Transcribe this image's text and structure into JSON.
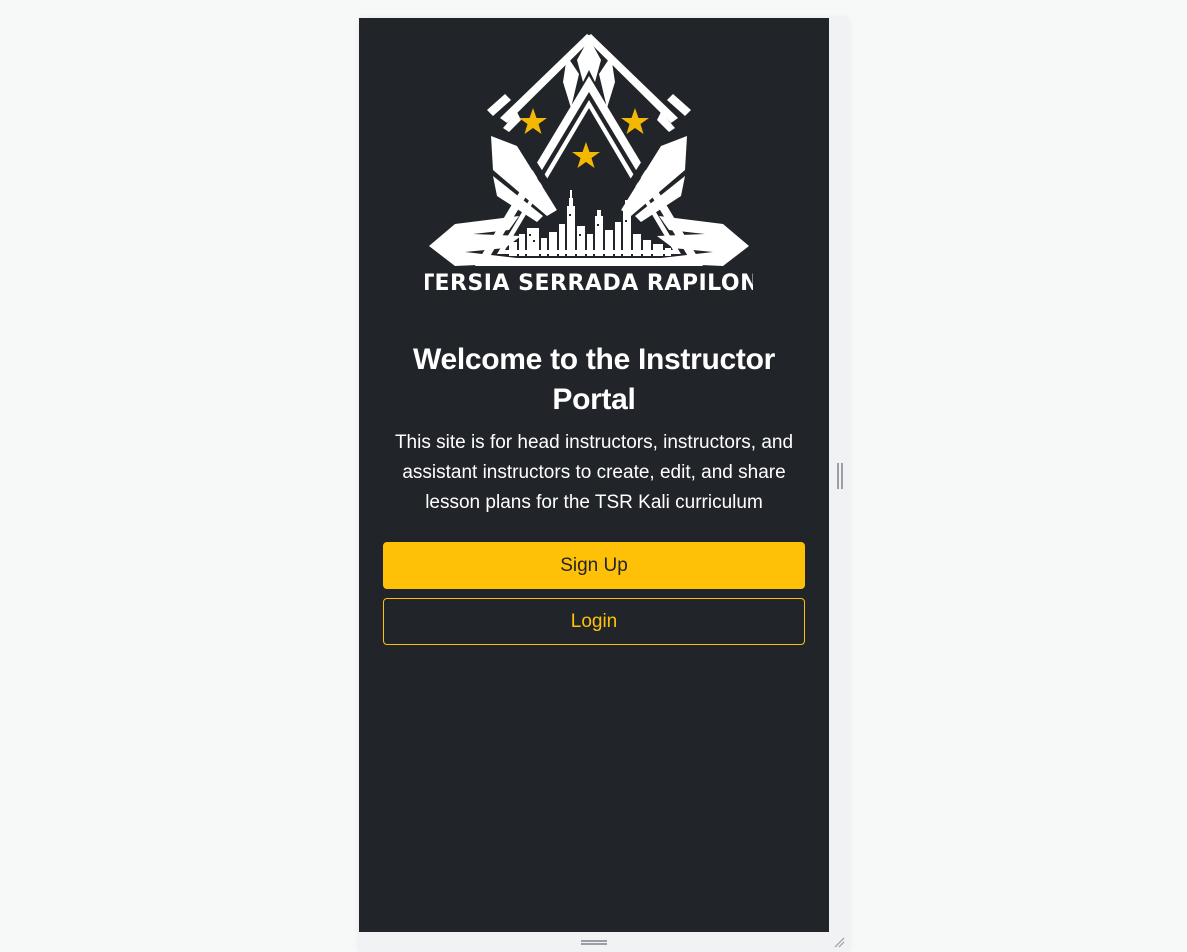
{
  "logo": {
    "text": "TERSIA SERRADA RAPILON",
    "icon": "tsr-crest-logo",
    "star_color": "#f5b800"
  },
  "main": {
    "title": "Welcome to the Instructor Portal",
    "description": "This site is for head instructors, instructors, and assistant instructors to create, edit, and share lesson plans for the TSR Kali curriculum"
  },
  "actions": {
    "signup_label": "Sign Up",
    "login_label": "Login"
  },
  "colors": {
    "background": "#212429",
    "accent": "#ffc107"
  }
}
